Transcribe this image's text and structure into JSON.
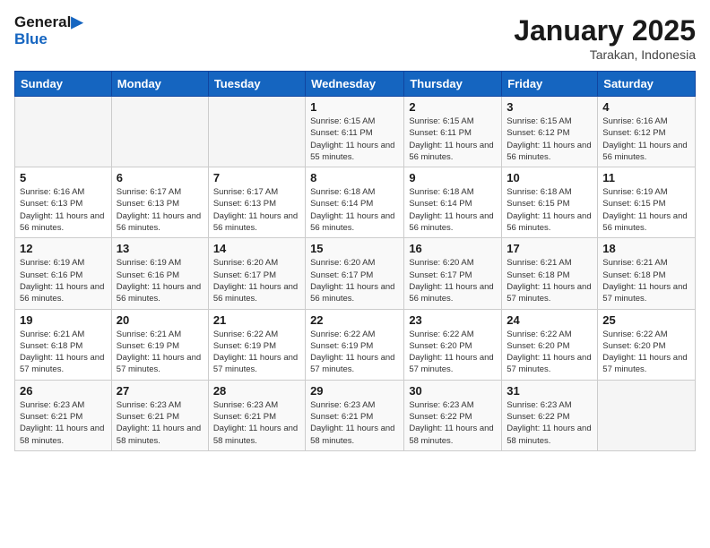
{
  "logo": {
    "line1": "General",
    "line2": "Blue"
  },
  "title": "January 2025",
  "subtitle": "Tarakan, Indonesia",
  "weekdays": [
    "Sunday",
    "Monday",
    "Tuesday",
    "Wednesday",
    "Thursday",
    "Friday",
    "Saturday"
  ],
  "weeks": [
    [
      {
        "day": "",
        "info": ""
      },
      {
        "day": "",
        "info": ""
      },
      {
        "day": "",
        "info": ""
      },
      {
        "day": "1",
        "info": "Sunrise: 6:15 AM\nSunset: 6:11 PM\nDaylight: 11 hours and 55 minutes."
      },
      {
        "day": "2",
        "info": "Sunrise: 6:15 AM\nSunset: 6:11 PM\nDaylight: 11 hours and 56 minutes."
      },
      {
        "day": "3",
        "info": "Sunrise: 6:15 AM\nSunset: 6:12 PM\nDaylight: 11 hours and 56 minutes."
      },
      {
        "day": "4",
        "info": "Sunrise: 6:16 AM\nSunset: 6:12 PM\nDaylight: 11 hours and 56 minutes."
      }
    ],
    [
      {
        "day": "5",
        "info": "Sunrise: 6:16 AM\nSunset: 6:13 PM\nDaylight: 11 hours and 56 minutes."
      },
      {
        "day": "6",
        "info": "Sunrise: 6:17 AM\nSunset: 6:13 PM\nDaylight: 11 hours and 56 minutes."
      },
      {
        "day": "7",
        "info": "Sunrise: 6:17 AM\nSunset: 6:13 PM\nDaylight: 11 hours and 56 minutes."
      },
      {
        "day": "8",
        "info": "Sunrise: 6:18 AM\nSunset: 6:14 PM\nDaylight: 11 hours and 56 minutes."
      },
      {
        "day": "9",
        "info": "Sunrise: 6:18 AM\nSunset: 6:14 PM\nDaylight: 11 hours and 56 minutes."
      },
      {
        "day": "10",
        "info": "Sunrise: 6:18 AM\nSunset: 6:15 PM\nDaylight: 11 hours and 56 minutes."
      },
      {
        "day": "11",
        "info": "Sunrise: 6:19 AM\nSunset: 6:15 PM\nDaylight: 11 hours and 56 minutes."
      }
    ],
    [
      {
        "day": "12",
        "info": "Sunrise: 6:19 AM\nSunset: 6:16 PM\nDaylight: 11 hours and 56 minutes."
      },
      {
        "day": "13",
        "info": "Sunrise: 6:19 AM\nSunset: 6:16 PM\nDaylight: 11 hours and 56 minutes."
      },
      {
        "day": "14",
        "info": "Sunrise: 6:20 AM\nSunset: 6:17 PM\nDaylight: 11 hours and 56 minutes."
      },
      {
        "day": "15",
        "info": "Sunrise: 6:20 AM\nSunset: 6:17 PM\nDaylight: 11 hours and 56 minutes."
      },
      {
        "day": "16",
        "info": "Sunrise: 6:20 AM\nSunset: 6:17 PM\nDaylight: 11 hours and 56 minutes."
      },
      {
        "day": "17",
        "info": "Sunrise: 6:21 AM\nSunset: 6:18 PM\nDaylight: 11 hours and 57 minutes."
      },
      {
        "day": "18",
        "info": "Sunrise: 6:21 AM\nSunset: 6:18 PM\nDaylight: 11 hours and 57 minutes."
      }
    ],
    [
      {
        "day": "19",
        "info": "Sunrise: 6:21 AM\nSunset: 6:18 PM\nDaylight: 11 hours and 57 minutes."
      },
      {
        "day": "20",
        "info": "Sunrise: 6:21 AM\nSunset: 6:19 PM\nDaylight: 11 hours and 57 minutes."
      },
      {
        "day": "21",
        "info": "Sunrise: 6:22 AM\nSunset: 6:19 PM\nDaylight: 11 hours and 57 minutes."
      },
      {
        "day": "22",
        "info": "Sunrise: 6:22 AM\nSunset: 6:19 PM\nDaylight: 11 hours and 57 minutes."
      },
      {
        "day": "23",
        "info": "Sunrise: 6:22 AM\nSunset: 6:20 PM\nDaylight: 11 hours and 57 minutes."
      },
      {
        "day": "24",
        "info": "Sunrise: 6:22 AM\nSunset: 6:20 PM\nDaylight: 11 hours and 57 minutes."
      },
      {
        "day": "25",
        "info": "Sunrise: 6:22 AM\nSunset: 6:20 PM\nDaylight: 11 hours and 57 minutes."
      }
    ],
    [
      {
        "day": "26",
        "info": "Sunrise: 6:23 AM\nSunset: 6:21 PM\nDaylight: 11 hours and 58 minutes."
      },
      {
        "day": "27",
        "info": "Sunrise: 6:23 AM\nSunset: 6:21 PM\nDaylight: 11 hours and 58 minutes."
      },
      {
        "day": "28",
        "info": "Sunrise: 6:23 AM\nSunset: 6:21 PM\nDaylight: 11 hours and 58 minutes."
      },
      {
        "day": "29",
        "info": "Sunrise: 6:23 AM\nSunset: 6:21 PM\nDaylight: 11 hours and 58 minutes."
      },
      {
        "day": "30",
        "info": "Sunrise: 6:23 AM\nSunset: 6:22 PM\nDaylight: 11 hours and 58 minutes."
      },
      {
        "day": "31",
        "info": "Sunrise: 6:23 AM\nSunset: 6:22 PM\nDaylight: 11 hours and 58 minutes."
      },
      {
        "day": "",
        "info": ""
      }
    ]
  ]
}
